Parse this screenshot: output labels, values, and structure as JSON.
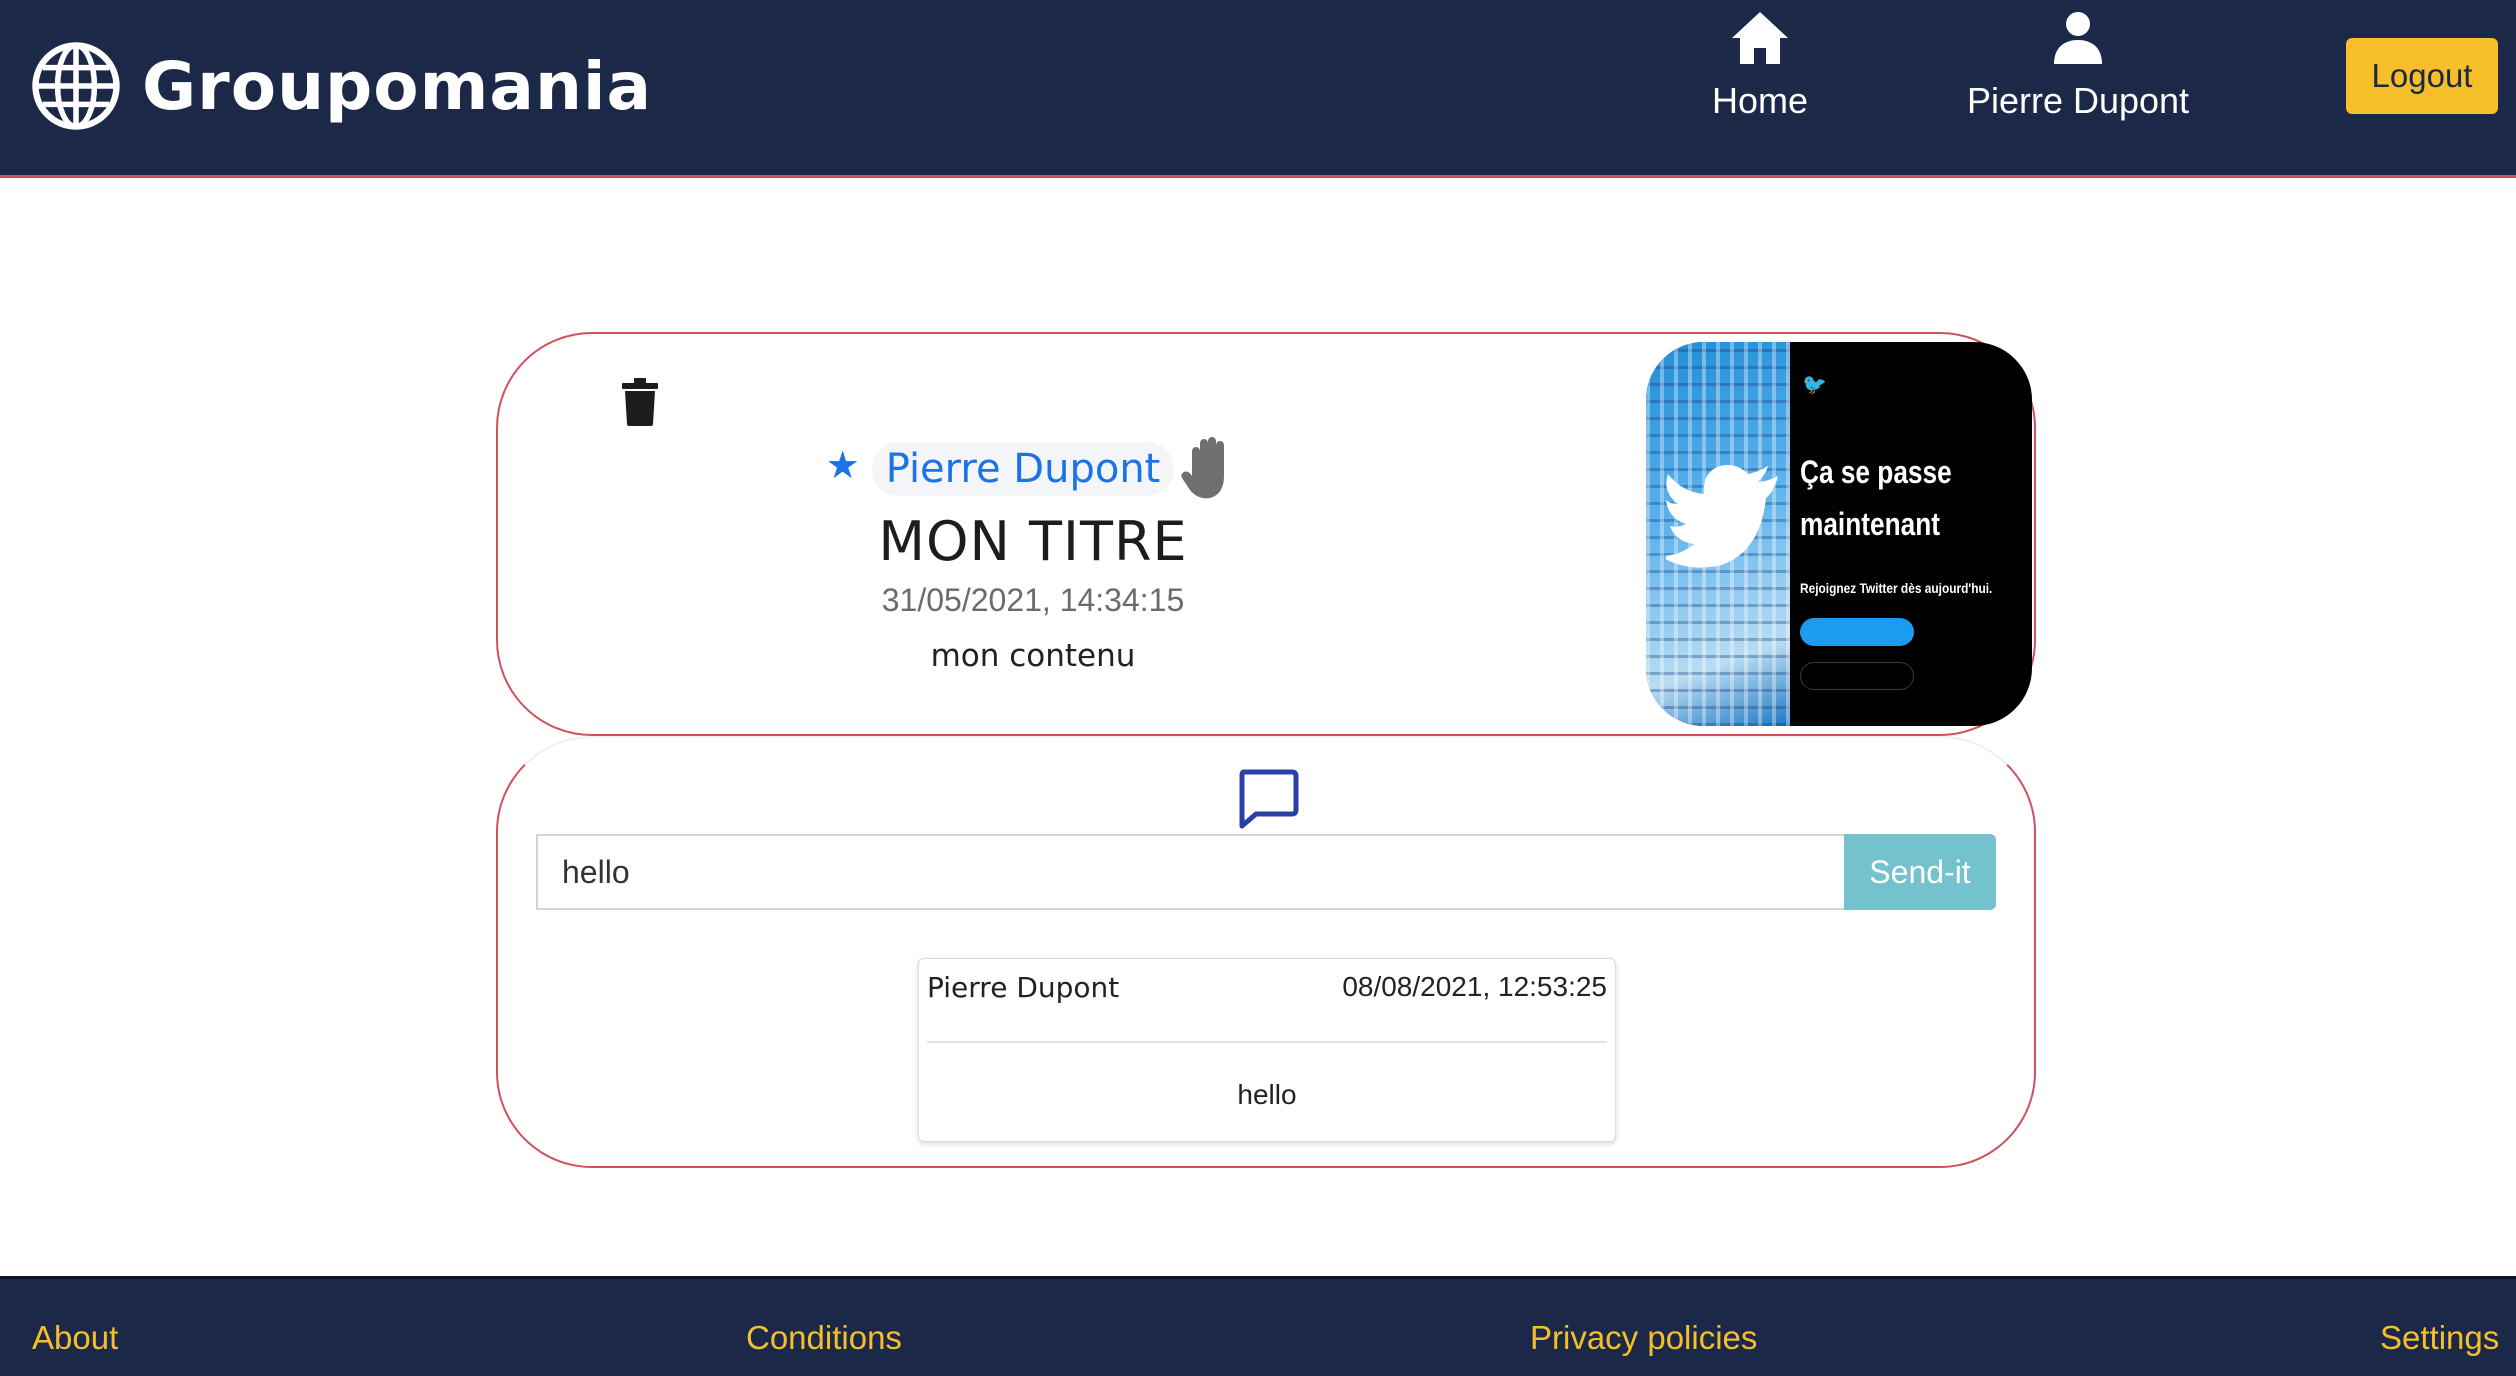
{
  "header": {
    "brand": "Groupomania",
    "nav": [
      {
        "label": "Home",
        "icon": "home-icon"
      },
      {
        "label": "Pierre Dupont",
        "icon": "user-icon"
      }
    ],
    "logout_label": "Logout"
  },
  "post": {
    "author": "Pierre Dupont",
    "title": "MON TITRE",
    "date": "31/05/2021, 14:34:15",
    "content": "mon contenu",
    "image_text": {
      "headline": "Ça se passe maintenant",
      "subtitle": "Rejoignez Twitter dès aujourd'hui."
    }
  },
  "comments": {
    "input_value": "hello",
    "send_label": "Send-it",
    "items": [
      {
        "author": "Pierre Dupont",
        "date": "08/08/2021, 12:53:25",
        "text": "hello"
      }
    ]
  },
  "footer": {
    "links": [
      "About",
      "Conditions",
      "Privacy policies",
      "Settings"
    ]
  },
  "colors": {
    "navy": "#1b2847",
    "accent_red": "#d1515a",
    "yellow": "#f6bf2a",
    "link_blue": "#1a73e8",
    "send_teal": "#74c2cd"
  }
}
